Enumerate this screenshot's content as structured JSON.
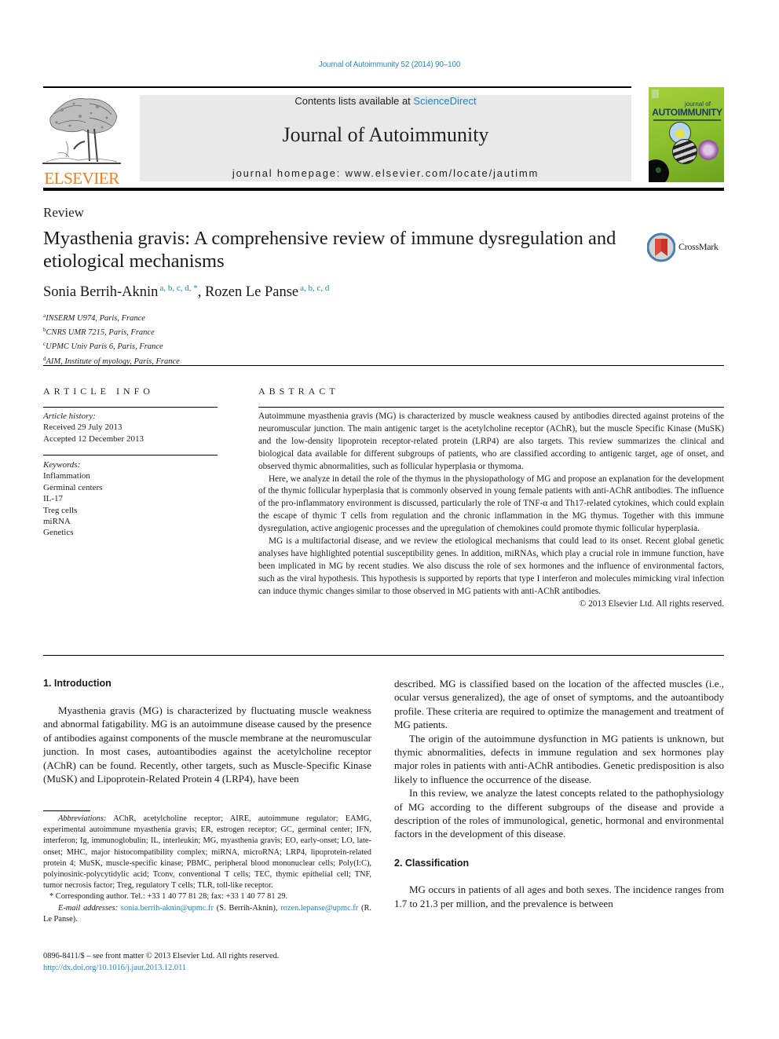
{
  "header": {
    "citation": "Journal of Autoimmunity 52 (2014) 90–100",
    "publisher_logo_text": "ELSEVIER",
    "contents_prefix": "Contents lists available at ",
    "contents_link": "ScienceDirect",
    "journal_title": "Journal of Autoimmunity",
    "homepage": "journal homepage: www.elsevier.com/locate/jautimm",
    "cover": {
      "small": "journal of",
      "big": "AUTOIMMUNITY"
    }
  },
  "article": {
    "type": "Review",
    "title": "Myasthenia gravis: A comprehensive review of immune dysregulation and etiological mechanisms",
    "crossmark_label": "CrossMark",
    "authors": [
      {
        "name": "Sonia Berrih-Aknin",
        "affils": "a, b, c, d, *"
      },
      {
        "name": "Rozen Le Panse",
        "affils": "a, b, c, d"
      }
    ],
    "author_separator": ", ",
    "affiliations": [
      {
        "mark": "a",
        "text": "INSERM U974, Paris, France"
      },
      {
        "mark": "b",
        "text": "CNRS UMR 7215, Paris, France"
      },
      {
        "mark": "c",
        "text": "UPMC Univ Paris 6, Paris, France"
      },
      {
        "mark": "d",
        "text": "AIM, Institute of myology, Paris, France"
      }
    ]
  },
  "article_info": {
    "heading": "ARTICLE INFO",
    "history_label": "Article history:",
    "received": "Received 29 July 2013",
    "accepted": "Accepted 12 December 2013",
    "keywords_label": "Keywords:",
    "keywords": [
      "Inflammation",
      "Germinal centers",
      "IL-17",
      "Treg cells",
      "miRNA",
      "Genetics"
    ]
  },
  "abstract": {
    "heading": "ABSTRACT",
    "paragraphs": [
      "Autoimmune myasthenia gravis (MG) is characterized by muscle weakness caused by antibodies directed against proteins of the neuromuscular junction. The main antigenic target is the acetylcholine receptor (AChR), but the muscle Specific Kinase (MuSK) and the low-density lipoprotein receptor-related protein (LRP4) are also targets. This review summarizes the clinical and biological data available for different subgroups of patients, who are classified according to antigenic target, age of onset, and observed thymic abnormalities, such as follicular hyperplasia or thymoma.",
      "Here, we analyze in detail the role of the thymus in the physiopathology of MG and propose an explanation for the development of the thymic follicular hyperplasia that is commonly observed in young female patients with anti-AChR antibodies. The influence of the pro-inflammatory environment is discussed, particularly the role of TNF-α and Th17-related cytokines, which could explain the escape of thymic T cells from regulation and the chronic inflammation in the MG thymus. Together with this immune dysregulation, active angiogenic processes and the upregulation of chemokines could promote thymic follicular hyperplasia.",
      "MG is a multifactorial disease, and we review the etiological mechanisms that could lead to its onset. Recent global genetic analyses have highlighted potential susceptibility genes. In addition, miRNAs, which play a crucial role in immune function, have been implicated in MG by recent studies. We also discuss the role of sex hormones and the influence of environmental factors, such as the viral hypothesis. This hypothesis is supported by reports that type I interferon and molecules mimicking viral infection can induce thymic changes similar to those observed in MG patients with anti-AChR antibodies."
    ],
    "copyright": "© 2013 Elsevier Ltd. All rights reserved."
  },
  "body": {
    "sections": [
      {
        "heading": "1.  Introduction",
        "paragraphs": [
          "Myasthenia gravis (MG) is characterized by fluctuating muscle weakness and abnormal fatigability. MG is an autoimmune disease caused by the presence of antibodies against components of the muscle membrane at the neuromuscular junction. In most cases, autoantibodies against the acetylcholine receptor (AChR) can be found. Recently, other targets, such as Muscle-Specific Kinase (MuSK) and Lipoprotein-Related Protein 4 (LRP4), have been",
          "described. MG is classified based on the location of the affected muscles (i.e., ocular versus generalized), the age of onset of symptoms, and the autoantibody profile. These criteria are required to optimize the management and treatment of MG patients.",
          "The origin of the autoimmune dysfunction in MG patients is unknown, but thymic abnormalities, defects in immune regulation and sex hormones play major roles in patients with anti-AChR antibodies. Genetic predisposition is also likely to influence the occurrence of the disease.",
          "In this review, we analyze the latest concepts related to the pathophysiology of MG according to the different subgroups of the disease and provide a description of the roles of immunological, genetic, hormonal and environmental factors in the development of this disease."
        ]
      },
      {
        "heading": "2.  Classification",
        "paragraphs": [
          "MG occurs in patients of all ages and both sexes. The incidence ranges from 1.7 to 21.3 per million, and the prevalence is between"
        ]
      }
    ]
  },
  "footnotes": {
    "abbreviations_label": "Abbreviations:",
    "abbreviations": " AChR, acetylcholine receptor; AIRE, autoimmune regulator; EAMG, experimental autoimmune myasthenia gravis; ER, estrogen receptor; GC, germinal center; IFN, interferon; Ig, immunoglobulin; IL, interleukin; MG, myasthenia gravis; EO, early-onset; LO, late-onset; MHC, major histocompatibility complex; miRNA, microRNA; LRP4, lipoprotein-related protein 4; MuSK, muscle-specific kinase; PBMC, peripheral blood mononuclear cells; Poly(I:C), polyinosinic-polycytidylic acid; Tconv, conventional T cells; TEC, thymic epithelial cell; TNF, tumor necrosis factor; Treg, regulatory T cells; TLR, toll-like receptor.",
    "corresponding": "* Corresponding author. Tel.: +33 1 40 77 81 28; fax: +33 1 40 77 81 29.",
    "email_label": "E-mail addresses:",
    "email1": "sonia.berrih-aknin@upmc.fr",
    "email1_owner": " (S. Berrih-Aknin), ",
    "email2": "rozen.lepanse@upmc.fr",
    "email2_owner": " (R. Le Panse).",
    "front_matter": "0896-8411/$ – see front matter © 2013 Elsevier Ltd. All rights reserved.",
    "doi": "http://dx.doi.org/10.1016/j.jaut.2013.12.011"
  },
  "colors": {
    "link": "#1a86c4",
    "elsevier_orange": "#f07c1a",
    "banner_gray": "#e9e9e9",
    "cover_green": "#8cc02e"
  }
}
